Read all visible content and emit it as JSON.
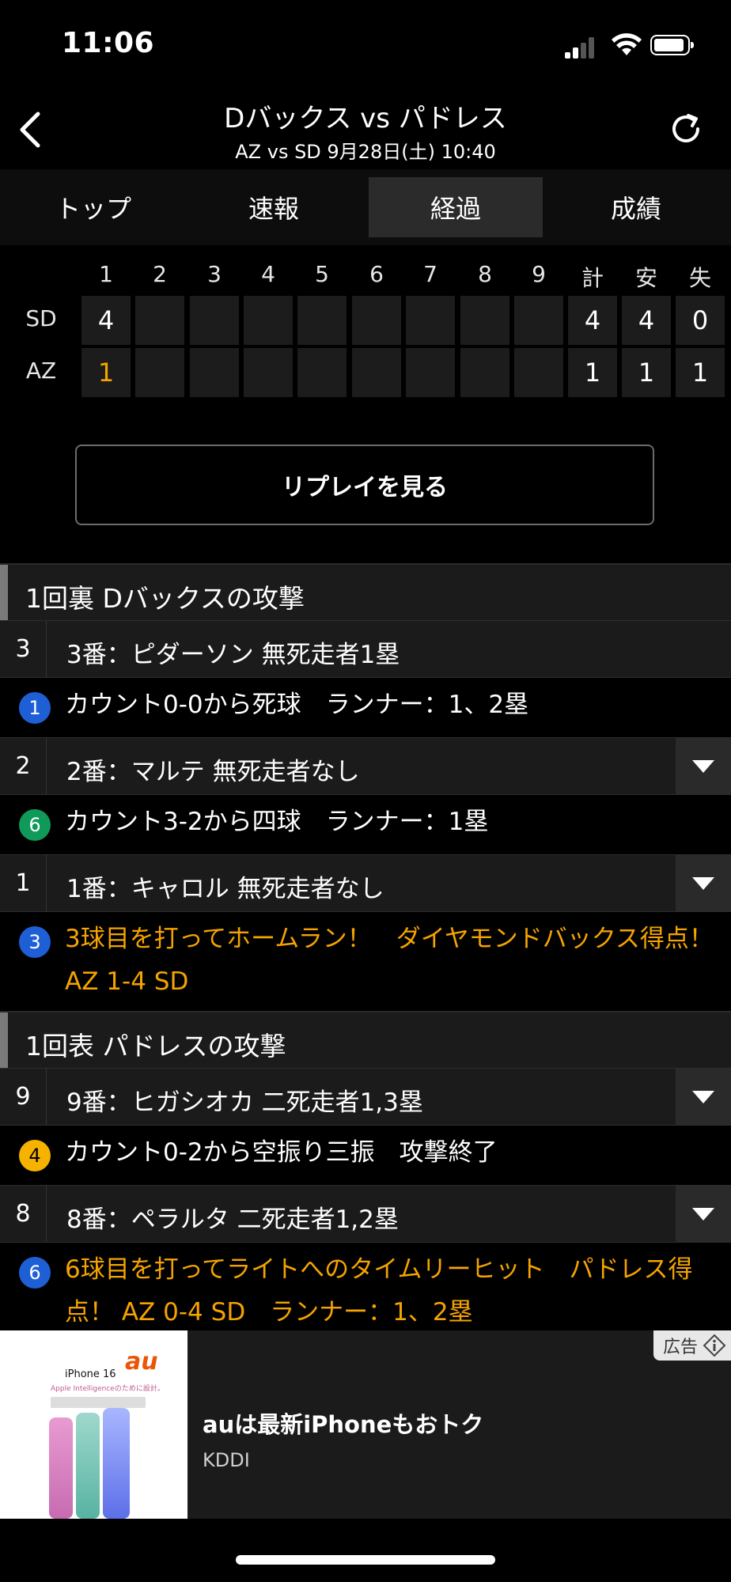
{
  "status_bar": {
    "time": "11:06"
  },
  "header": {
    "title": "Dバックス vs パドレス",
    "subtitle": "AZ vs SD 9月28日(土) 10:40"
  },
  "tabs": [
    {
      "label": "トップ",
      "active": false
    },
    {
      "label": "速報",
      "active": false
    },
    {
      "label": "経過",
      "active": true
    },
    {
      "label": "成績",
      "active": false
    }
  ],
  "scoreboard": {
    "headers": [
      "1",
      "2",
      "3",
      "4",
      "5",
      "6",
      "7",
      "8",
      "9",
      "計",
      "安",
      "失"
    ],
    "rows": [
      {
        "team": "SD",
        "innings": [
          "4",
          "",
          "",
          "",
          "",
          "",
          "",
          "",
          ""
        ],
        "totals": [
          "4",
          "4",
          "0"
        ]
      },
      {
        "team": "AZ",
        "innings": [
          "1",
          "",
          "",
          "",
          "",
          "",
          "",
          "",
          ""
        ],
        "totals": [
          "1",
          "1",
          "1"
        ]
      }
    ]
  },
  "replay_button": "リプレイを見る",
  "play_by_play": [
    {
      "type": "section",
      "text": "1回裏 Dバックスの攻撃"
    },
    {
      "type": "batter",
      "order": "3",
      "text": "3番：ピダーソン   無死走者1塁",
      "expandable": false
    },
    {
      "type": "event",
      "badge": "1",
      "badge_color": "#1f5fd6",
      "text": "カウント0-0から死球　ランナー：1、2塁",
      "highlight": false
    },
    {
      "type": "batter",
      "order": "2",
      "text": "2番：マルテ   無死走者なし",
      "expandable": true
    },
    {
      "type": "event",
      "badge": "6",
      "badge_color": "#0f9a5a",
      "text": "カウント3-2から四球　ランナー：1塁",
      "highlight": false
    },
    {
      "type": "batter",
      "order": "1",
      "text": "1番：キャロル   無死走者なし",
      "expandable": true
    },
    {
      "type": "event",
      "badge": "3",
      "badge_color": "#1f5fd6",
      "text": "3球目を打ってホームラン！　ダイヤモンドバックス得点！ AZ 1-4 SD",
      "highlight": true
    },
    {
      "type": "section",
      "text": "1回表 パドレスの攻撃"
    },
    {
      "type": "batter",
      "order": "9",
      "text": "9番：ヒガシオカ   二死走者1,3塁",
      "expandable": true
    },
    {
      "type": "event",
      "badge": "4",
      "badge_color": "#f5b300",
      "text": "カウント0-2から空振り三振　攻撃終了",
      "highlight": false
    },
    {
      "type": "batter",
      "order": "8",
      "text": "8番：ペラルタ   二死走者1,2塁",
      "expandable": true
    },
    {
      "type": "event",
      "badge": "6",
      "badge_color": "#1f5fd6",
      "text": "6球目を打ってライトへのタイムリーヒット　パドレス得点！ AZ 0-4 SD　ランナー：1、2塁",
      "highlight": true
    }
  ],
  "ad": {
    "tag": "広告",
    "title": "auは最新iPhoneもおトク",
    "source": "KDDI",
    "image": {
      "brand": "au",
      "product": "iPhone 16",
      "tagline": "Apple Intelligenceのために設計。"
    }
  }
}
